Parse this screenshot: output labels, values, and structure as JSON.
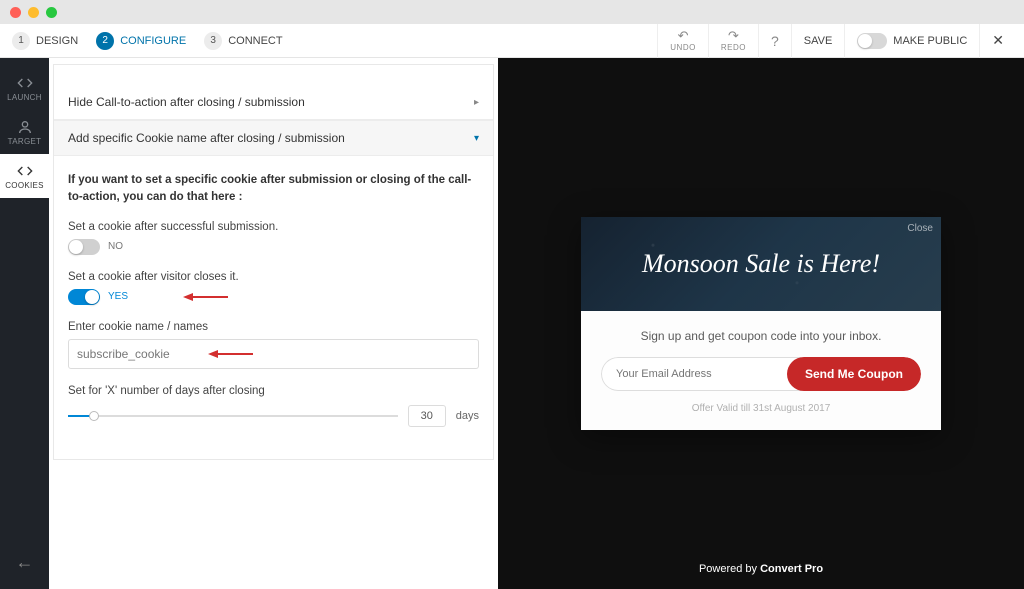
{
  "steps": [
    {
      "num": "1",
      "label": "DESIGN"
    },
    {
      "num": "2",
      "label": "CONFIGURE"
    },
    {
      "num": "3",
      "label": "CONNECT"
    }
  ],
  "toolbar": {
    "undo": "UNDO",
    "redo": "REDO",
    "save": "SAVE",
    "publish": "MAKE PUBLIC"
  },
  "rail": {
    "launch": "LAUNCH",
    "target": "TARGET",
    "cookies": "COOKIES"
  },
  "accordion": {
    "hide_cta": "Hide Call-to-action after closing / submission",
    "add_cookie": "Add specific Cookie name after closing / submission"
  },
  "cookie_panel": {
    "intro": "If you want to set a specific cookie after submission or closing of the call-to-action, you can do that here :",
    "after_submission_label": "Set a cookie after successful submission.",
    "after_submission_val": "NO",
    "after_close_label": "Set a cookie after visitor closes it.",
    "after_close_val": "YES",
    "name_label": "Enter cookie name / names",
    "name_value": "subscribe_cookie",
    "days_label": "Set for 'X' number of days after closing",
    "days_value": "30",
    "days_suffix": "days"
  },
  "preview": {
    "hero_title": "Monsoon Sale is Here!",
    "close": "Close",
    "subtitle": "Sign up and get coupon code into your inbox.",
    "email_placeholder": "Your Email Address",
    "cta": "Send Me Coupon",
    "validity": "Offer Valid till 31st August 2017",
    "powered_by": "Powered by ",
    "brand": "Convert Pro"
  }
}
